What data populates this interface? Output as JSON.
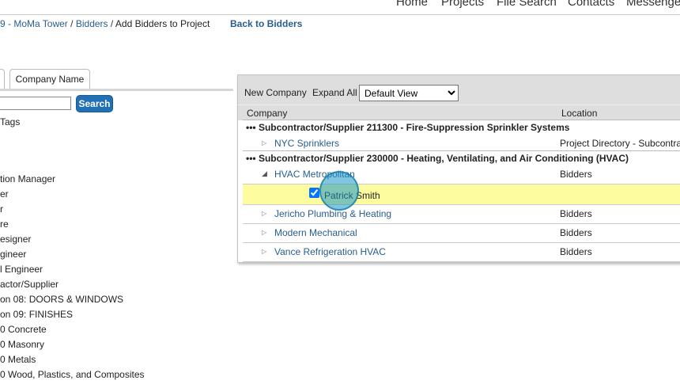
{
  "topnav": {
    "items": [
      "Home",
      "Projects",
      "File Search",
      "Contacts",
      "Messenger"
    ]
  },
  "breadcrumb": {
    "project": "9 - MoMa Tower",
    "sep1": "/",
    "bidders": "Bidders",
    "sep2": "/",
    "current": "Add Bidders to Project"
  },
  "back_link": "Back to Bidders",
  "left_panel": {
    "tab_label": "Company Name",
    "search_value": "",
    "search_button": "Search",
    "tags_label": "Tags",
    "filters": [
      "tion Manager",
      "er",
      "r",
      "re",
      "esigner",
      "gineer",
      "l Engineer",
      "actor/Supplier",
      "on 08: DOORS & WINDOWS",
      "on 09: FINISHES",
      "0 Concrete",
      "0 Masonry",
      "0 Metals",
      "0 Wood, Plastics, and Composites"
    ]
  },
  "panel": {
    "new_company": "New Company",
    "expand_all": "Expand All",
    "view_selected": "Default View",
    "col_company": "Company",
    "col_location": "Location",
    "group1": "Subcontractor/Supplier 211300 - Fire-Suppression Sprinkler Systems",
    "group1_dots": "•••",
    "row1_name": "NYC Sprinklers",
    "row1_loc": "Project Directory - Subcontractor",
    "group2": "Subcontractor/Supplier 230000 - Heating, Ventilating, and Air Conditioning (HVAC)",
    "group2_dots": "•••",
    "row2_name": "HVAC Metropolitan",
    "row2_loc": "Bidders",
    "contact_name": "Patrick Smith",
    "row3_name": "Jericho Plumbing & Heating",
    "row3_loc": "Bidders",
    "row4_name": "Modern Mechanical",
    "row4_loc": "Bidders",
    "row5_name": "Vance Refrigeration HVAC",
    "row5_loc": "Bidders"
  },
  "icons": {
    "collapsed": "triangle-right-icon",
    "expanded": "triangle-down-icon"
  }
}
